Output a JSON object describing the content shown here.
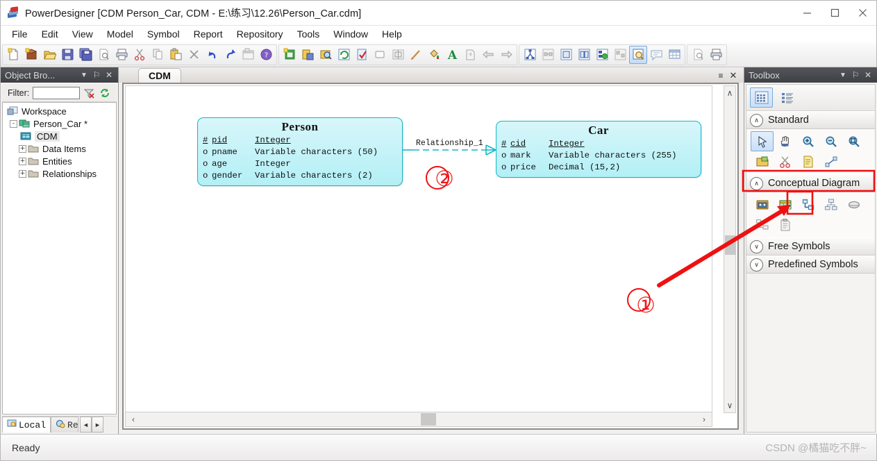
{
  "window": {
    "title": "PowerDesigner [CDM Person_Car, CDM - E:\\练习\\12.26\\Person_Car.cdm]",
    "app_icon": "powerdesigner-icon",
    "minimize": "—",
    "maximize": "☐",
    "close": "✕"
  },
  "menubar": {
    "items": [
      {
        "label": "File"
      },
      {
        "label": "Edit"
      },
      {
        "label": "View"
      },
      {
        "label": "Model"
      },
      {
        "label": "Symbol"
      },
      {
        "label": "Report"
      },
      {
        "label": "Repository"
      },
      {
        "label": "Tools"
      },
      {
        "label": "Window"
      },
      {
        "label": "Help"
      }
    ]
  },
  "toolbar": {
    "groups": [
      {
        "buttons": [
          {
            "name": "new-model-icon"
          },
          {
            "name": "new-package-icon"
          },
          {
            "name": "open-icon"
          },
          {
            "name": "save-icon"
          },
          {
            "name": "save-all-icon"
          },
          {
            "name": "print-preview-icon"
          },
          {
            "name": "print-icon"
          },
          {
            "name": "cut-icon"
          },
          {
            "name": "copy-icon"
          },
          {
            "name": "paste-icon"
          },
          {
            "name": "delete-icon"
          },
          {
            "name": "undo-icon"
          },
          {
            "name": "redo-icon"
          },
          {
            "name": "properties-icon"
          },
          {
            "name": "help-icon"
          }
        ]
      },
      {
        "buttons": [
          {
            "name": "new-diagram-icon"
          },
          {
            "name": "save-diagram-icon"
          },
          {
            "name": "find-object-icon"
          },
          {
            "name": "refresh-icon"
          },
          {
            "name": "check-model-icon"
          },
          {
            "name": "shape-icon"
          },
          {
            "name": "align-icon"
          },
          {
            "name": "format-brush-icon"
          },
          {
            "name": "fill-color-icon"
          },
          {
            "name": "font-icon"
          },
          {
            "name": "export-icon"
          },
          {
            "name": "back-icon"
          },
          {
            "name": "forward-icon"
          }
        ]
      },
      {
        "buttons": [
          {
            "name": "dependency-matrix-icon"
          },
          {
            "name": "impact-analysis-icon"
          },
          {
            "name": "list-view-icon"
          },
          {
            "name": "grid-view-icon"
          },
          {
            "name": "merge-model-icon"
          },
          {
            "name": "compare-model-icon"
          },
          {
            "name": "zoom-diagram-icon",
            "selected": true
          },
          {
            "name": "comment-icon"
          },
          {
            "name": "table-icon"
          }
        ]
      },
      {
        "buttons": [
          {
            "name": "preview-icon"
          },
          {
            "name": "print-report-icon"
          }
        ]
      }
    ]
  },
  "object_browser": {
    "caption": "Object Bro...",
    "caption_buttons": [
      {
        "name": "dropdown-icon",
        "glyph": "▼"
      },
      {
        "name": "pin-icon",
        "glyph": "⚐"
      },
      {
        "name": "close-icon",
        "glyph": "✕"
      }
    ],
    "filter": {
      "label": "Filter:",
      "value": "",
      "placeholder": ""
    },
    "filter_buttons": [
      {
        "name": "clear-filter-icon"
      },
      {
        "name": "refresh-tree-icon"
      }
    ],
    "tree": [
      {
        "label": "Workspace",
        "depth": 0,
        "icon": "workspace-icon",
        "expander": ""
      },
      {
        "label": "Person_Car *",
        "depth": 1,
        "icon": "model-icon",
        "expander": "-"
      },
      {
        "label": "CDM",
        "depth": 2,
        "icon": "cdm-diagram-icon",
        "expander": "",
        "selected": true
      },
      {
        "label": "Data Items",
        "depth": 2,
        "icon": "folder-icon",
        "expander": "+"
      },
      {
        "label": "Entities",
        "depth": 2,
        "icon": "folder-icon",
        "expander": "+"
      },
      {
        "label": "Relationships",
        "depth": 2,
        "icon": "folder-icon",
        "expander": "+"
      }
    ],
    "tabs": [
      {
        "label": "Local",
        "icon": "local-icon",
        "active": true
      },
      {
        "label": "Rep",
        "icon": "repository-icon",
        "active": false
      }
    ],
    "tab_arrows": [
      {
        "glyph": "◄"
      },
      {
        "glyph": "►"
      }
    ]
  },
  "center": {
    "tab": {
      "label": "CDM"
    },
    "tab_buttons": [
      {
        "name": "tab-list-icon",
        "glyph": "≡"
      },
      {
        "name": "close-tab-icon",
        "glyph": "✕"
      }
    ],
    "scroll": {
      "up": "∧",
      "down": "∨",
      "left": "‹",
      "right": "›"
    }
  },
  "diagram": {
    "entities": [
      {
        "name": "Person",
        "attributes": [
          {
            "key": "#",
            "name": "pid",
            "type": "Integer",
            "primary": true
          },
          {
            "key": "o",
            "name": "pname",
            "type": "Variable characters (50)",
            "primary": false
          },
          {
            "key": "o",
            "name": "age",
            "type": "Integer",
            "primary": false
          },
          {
            "key": "o",
            "name": "gender",
            "type": "Variable characters (2)",
            "primary": false
          }
        ]
      },
      {
        "name": "Car",
        "attributes": [
          {
            "key": "#",
            "name": "cid",
            "type": "Integer",
            "primary": true
          },
          {
            "key": "o",
            "name": "mark",
            "type": "Variable characters (255)",
            "primary": false
          },
          {
            "key": "o",
            "name": "price",
            "type": "Decimal (15,2)",
            "primary": false
          }
        ]
      }
    ],
    "relationship": {
      "label": "Relationship_1"
    },
    "annotations": [
      {
        "name": "callout-2",
        "text": "②"
      },
      {
        "name": "callout-1",
        "text": "①"
      }
    ]
  },
  "toolbox": {
    "caption": "Toolbox",
    "caption_buttons": [
      {
        "name": "dropdown-icon",
        "glyph": "▼"
      },
      {
        "name": "pin-icon",
        "glyph": "⚐"
      },
      {
        "name": "close-icon",
        "glyph": "✕"
      }
    ],
    "top_buttons": [
      {
        "name": "grid-layout-icon",
        "selected": true
      },
      {
        "name": "list-layout-icon",
        "selected": false
      }
    ],
    "sections": [
      {
        "title": "Standard",
        "expanded": true,
        "chevron": "∧",
        "tools": [
          {
            "name": "pointer-tool-icon",
            "selected": true
          },
          {
            "name": "grabber-tool-icon",
            "selected": false
          },
          {
            "name": "zoom-in-tool-icon",
            "selected": false
          },
          {
            "name": "zoom-out-tool-icon",
            "selected": false
          },
          {
            "name": "zoom-area-tool-icon",
            "selected": false
          },
          {
            "name": "open-package-tool-icon",
            "selected": false
          },
          {
            "name": "delete-tool-icon",
            "selected": false
          },
          {
            "name": "note-tool-icon",
            "selected": false
          },
          {
            "name": "link-tool-icon",
            "selected": false
          }
        ]
      },
      {
        "title": "Conceptual Diagram",
        "expanded": true,
        "chevron": "∧",
        "highlighted": true,
        "tools": [
          {
            "name": "package-tool-icon",
            "selected": false
          },
          {
            "name": "entity-tool-icon",
            "selected": false
          },
          {
            "name": "relationship-tool-icon",
            "selected": false,
            "highlighted": true
          },
          {
            "name": "inheritance-tool-icon",
            "selected": false
          },
          {
            "name": "association-tool-icon",
            "selected": false
          },
          {
            "name": "association-link-tool-icon",
            "selected": false
          },
          {
            "name": "file-tool-icon",
            "selected": false
          }
        ]
      },
      {
        "title": "Free Symbols",
        "expanded": false,
        "chevron": "∨",
        "tools": []
      },
      {
        "title": "Predefined Symbols",
        "expanded": false,
        "chevron": "∨",
        "tools": []
      }
    ]
  },
  "statusbar": {
    "text": "Ready",
    "watermark": "CSDN @橘猫吃不胖~"
  },
  "colors": {
    "entity_border": "#14b8c4",
    "entity_fill": "#b2f0f6",
    "annotation_red": "#ef1b1b",
    "selection_blue": "#7aa8d6",
    "panel_caption": "#474950"
  }
}
